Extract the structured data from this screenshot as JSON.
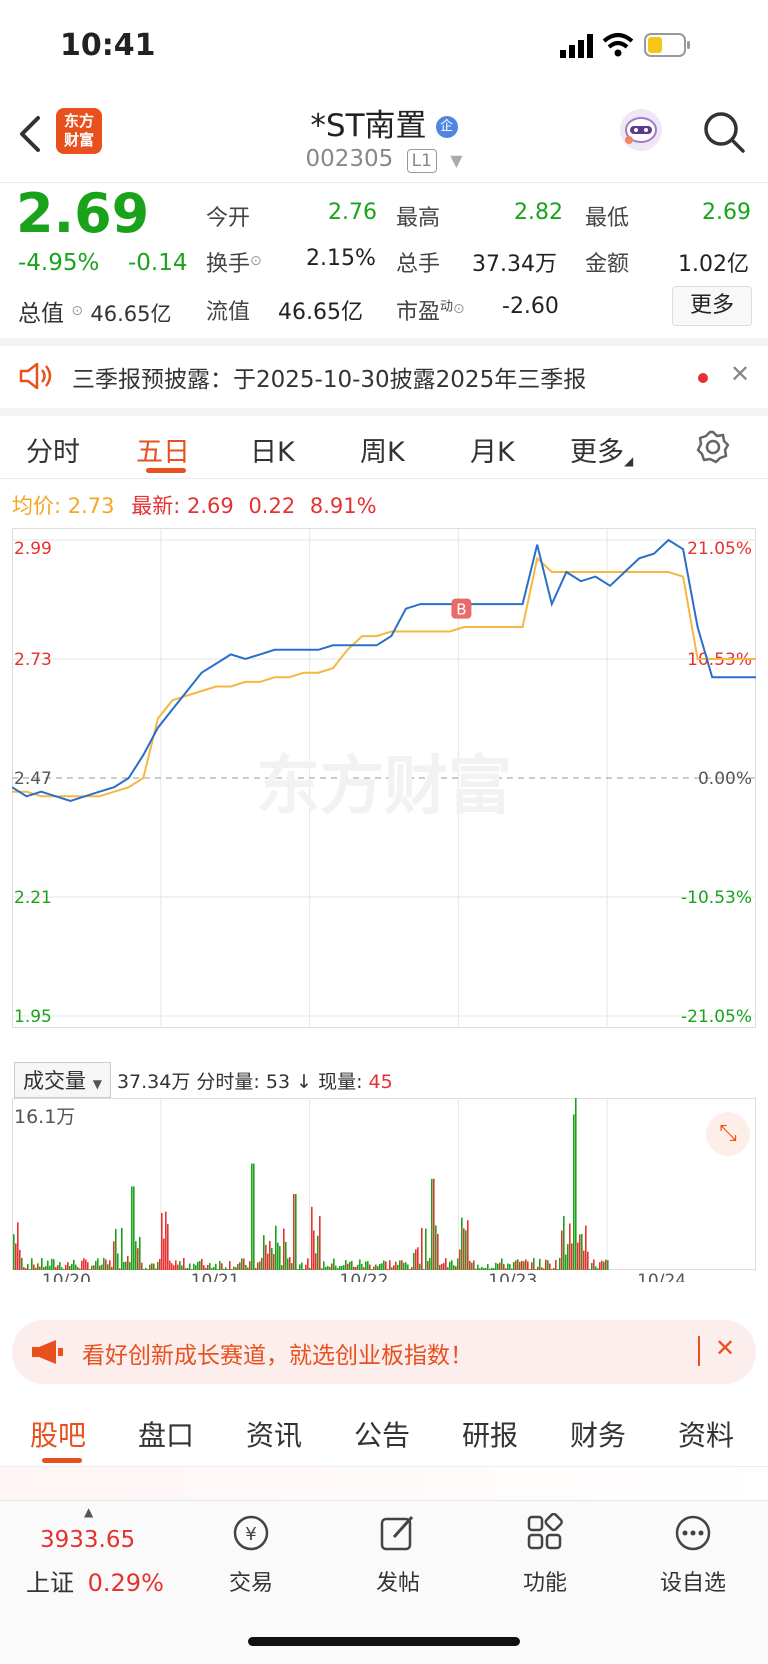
{
  "status_bar": {
    "time": "10:41"
  },
  "header": {
    "logo_line1": "东方",
    "logo_line2": "财富",
    "title": "*ST南置",
    "badge": "企",
    "code": "002305",
    "level": "L1"
  },
  "quote": {
    "price": "2.69",
    "change_pct": "-4.95%",
    "change": "-0.14",
    "total_value_label": "总值",
    "total_value": "46.65亿",
    "fields": [
      {
        "label": "今开",
        "value": "2.76"
      },
      {
        "label": "最高",
        "value": "2.82"
      },
      {
        "label": "最低",
        "value": "2.69"
      },
      {
        "label": "换手",
        "value": "2.15%"
      },
      {
        "label": "总手",
        "value": "37.34万"
      },
      {
        "label": "金额",
        "value": "1.02亿"
      },
      {
        "label": "流值",
        "value": "46.65亿"
      },
      {
        "label": "市盈",
        "label_sup": "动",
        "value": "-2.60"
      }
    ],
    "more_button": "更多"
  },
  "notice": {
    "text": "三季报预披露：于2025-10-30披露2025年三季报"
  },
  "tabs": [
    "分时",
    "五日",
    "日K",
    "周K",
    "月K",
    "更多"
  ],
  "chart_info": {
    "avg_label": "均价:",
    "avg_value": "2.73",
    "latest_label": "最新:",
    "latest_value": "2.69",
    "latest_change": "0.22",
    "latest_pct": "8.91%"
  },
  "volume_info": {
    "selector": "成交量",
    "total": "37.34万",
    "minute_label": "分时量:",
    "minute_value": "53",
    "current_label": "现量:",
    "current_value": "45",
    "max_label": "16.1万"
  },
  "ad": {
    "text": "看好创新成长赛道，就选创业板指数！"
  },
  "sub_tabs": [
    "股吧",
    "盘口",
    "资讯",
    "公告",
    "研报",
    "财务",
    "资料"
  ],
  "bottom_bar": {
    "index_value": "3933.65",
    "index_name": "上证",
    "index_pct": "0.29%",
    "nav": [
      "交易",
      "发帖",
      "功能",
      "设自选"
    ]
  },
  "colors": {
    "up": "#e63131",
    "down": "#1aa31a",
    "price_line": "#2a6fc9",
    "avg_line": "#f5b642",
    "accent": "#e8501e"
  },
  "chart_data": {
    "type": "line",
    "title": "",
    "y_left_ticks": [
      "2.99",
      "2.73",
      "2.47",
      "2.21",
      "1.95"
    ],
    "y_right_ticks": [
      "21.05%",
      "10.53%",
      "0.00%",
      "-10.53%",
      "-21.05%"
    ],
    "x_ticks": [
      "10/20",
      "10/21",
      "10/22",
      "10/23",
      "10/24"
    ],
    "ylim": [
      1.95,
      2.99
    ],
    "prev_close": 2.47,
    "watermark": "东方财富",
    "buy_marker": "B",
    "series": [
      {
        "values": [
          2.45,
          2.43,
          2.44,
          2.43,
          2.42,
          2.43,
          2.44,
          2.45,
          2.47,
          2.52,
          2.58,
          2.62,
          2.66,
          2.7,
          2.72,
          2.74,
          2.73,
          2.74,
          2.75,
          2.75,
          2.75,
          2.75,
          2.76,
          2.76,
          2.76,
          2.76,
          2.78,
          2.84,
          2.85,
          2.85,
          2.85,
          2.85,
          2.85,
          2.85,
          2.85,
          2.85,
          2.98,
          2.85,
          2.92,
          2.9,
          2.91,
          2.89,
          2.92,
          2.95,
          2.96,
          2.99,
          2.97,
          2.8,
          2.69,
          2.69,
          2.69,
          2.69
        ]
      },
      {
        "values": [
          2.44,
          2.44,
          2.43,
          2.43,
          2.43,
          2.43,
          2.43,
          2.44,
          2.45,
          2.47,
          2.6,
          2.64,
          2.65,
          2.66,
          2.67,
          2.67,
          2.68,
          2.68,
          2.69,
          2.69,
          2.7,
          2.7,
          2.71,
          2.75,
          2.78,
          2.78,
          2.79,
          2.79,
          2.79,
          2.79,
          2.79,
          2.8,
          2.8,
          2.8,
          2.8,
          2.8,
          2.95,
          2.92,
          2.92,
          2.92,
          2.92,
          2.92,
          2.92,
          2.92,
          2.92,
          2.92,
          2.91,
          2.73,
          2.73,
          2.73,
          2.73,
          2.73
        ]
      }
    ]
  }
}
